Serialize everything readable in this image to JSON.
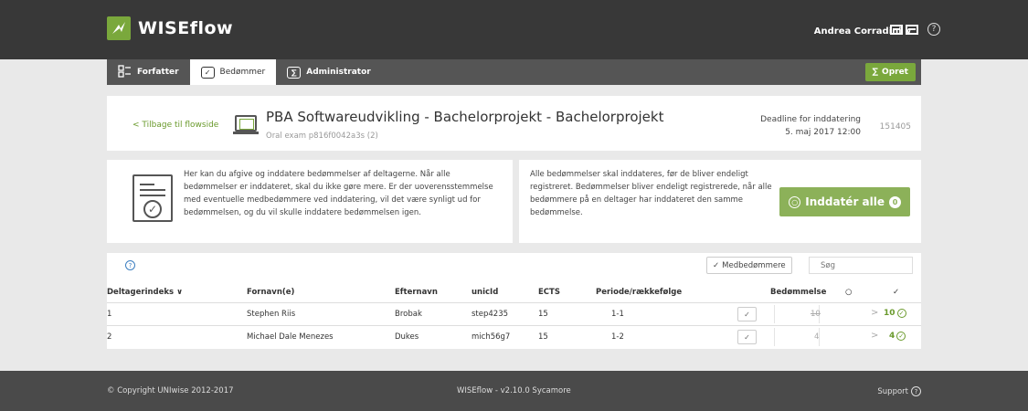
{
  "app": {
    "name": "WISEflow"
  },
  "user": {
    "name": "Andrea Corradini"
  },
  "nav": {
    "tabs": [
      {
        "label": "Forfatter"
      },
      {
        "label": "Bedømmer"
      },
      {
        "label": "Administrator"
      }
    ],
    "create_label": "Opret"
  },
  "flow": {
    "back_label": "Tilbage til flowside",
    "title": "PBA Softwareudvikling - Bachelorprojekt - Bachelorprojekt",
    "subtitle": "Oral exam p816f0042a3s (2)",
    "deadline_label": "Deadline for inddatering",
    "deadline_value": "5. maj 2017 12:00",
    "id": "151405"
  },
  "info": {
    "left_text": "Her kan du afgive og inddatere bedømmelser af deltagerne. Når alle bedømmelser er inddateret, skal du ikke gøre mere. Er der uoverensstemmelse med eventuelle medbedømmere ved inddatering, vil det være synligt ud for bedømmelsen, og du vil skulle inddatere bedømmelsen igen.",
    "right_text": "Alle bedømmelser skal inddateres, før de bliver endeligt registreret. Bedømmelser bliver endeligt registrerede, når alle bedømmere på en deltager har inddateret den samme bedømmelse.",
    "inddater_label": "Inddatér alle",
    "inddater_count": "0"
  },
  "table": {
    "help": "?",
    "medbedommere_label": "Medbedømmere",
    "search_placeholder": "Søg",
    "headers": {
      "index": "Deltagerindeks",
      "firstname": "Fornavn(e)",
      "lastname": "Efternavn",
      "unicid": "unicId",
      "ects": "ECTS",
      "period": "Periode/rækkefølge",
      "grade": "Bedømmelse"
    },
    "rows": [
      {
        "index": "1",
        "firstname": "Stephen Riis",
        "lastname": "Brobak",
        "unicid": "step4235",
        "ects": "15",
        "period": "1-1",
        "grade": "10",
        "final": "10"
      },
      {
        "index": "2",
        "firstname": "Michael Dale Menezes",
        "lastname": "Dukes",
        "unicid": "mich56g7",
        "ects": "15",
        "period": "1-2",
        "grade": "4",
        "final": "4"
      }
    ]
  },
  "footer": {
    "copyright": "© Copyright UNIwise 2012-2017",
    "version": "WISEflow - v2.10.0 Sycamore",
    "support": "Support"
  },
  "colors": {
    "accent": "#7aa83c",
    "header_bg": "#383838",
    "nav_bg": "#555555",
    "link_blue": "#3c7fc1"
  }
}
